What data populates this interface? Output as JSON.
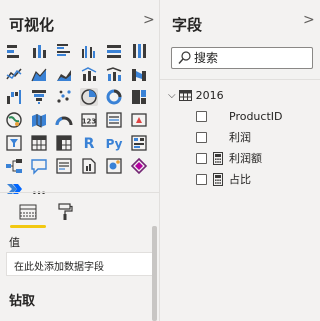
{
  "visualizations": {
    "title": "可视化",
    "icons": [
      "stacked-bar-chart-icon",
      "stacked-column-chart-icon",
      "clustered-bar-chart-icon",
      "clustered-column-chart-icon",
      "100-stacked-bar-chart-icon",
      "100-stacked-column-chart-icon",
      "line-chart-icon",
      "area-chart-icon",
      "stacked-area-chart-icon",
      "line-clustered-column-icon",
      "line-stacked-column-icon",
      "ribbon-chart-icon",
      "waterfall-chart-icon",
      "funnel-chart-icon",
      "scatter-chart-icon",
      "pie-chart-icon",
      "donut-chart-icon",
      "treemap-icon",
      "map-icon",
      "filled-map-icon",
      "gauge-icon",
      "card-icon",
      "multi-row-card-icon",
      "kpi-icon",
      "slicer-icon",
      "table-icon",
      "matrix-icon",
      "r-script-icon",
      "python-visual-icon",
      "key-influencers-icon",
      "decomposition-tree-icon",
      "qa-icon",
      "smart-narrative-icon",
      "paginated-report-icon",
      "arcgis-map-icon",
      "power-apps-icon",
      "power-automate-icon",
      "more-visuals-icon"
    ],
    "labels": {
      "r": "R",
      "py": "Py",
      "more": "..."
    },
    "tabs": [
      "fields-tab",
      "format-tab"
    ],
    "values_label": "值",
    "well_placeholder": "在此处添加数据字段",
    "drill_label": "钻取",
    "collapse_glyph": ">"
  },
  "fields": {
    "title": "字段",
    "collapse_glyph": ">",
    "search_placeholder": "搜索",
    "table": {
      "name": "2016",
      "expanded_glyph": "⌵",
      "items": [
        {
          "name": "ProductID",
          "icon": ""
        },
        {
          "name": "利润",
          "icon": ""
        },
        {
          "name": "利润额",
          "icon": "calculator-icon"
        },
        {
          "name": "占比",
          "icon": "calculator-icon"
        }
      ]
    }
  },
  "colors": {
    "accent_yellow": "#f2c811",
    "icon_blue": "#3a82d6",
    "icon_dark": "#3b3a39"
  }
}
